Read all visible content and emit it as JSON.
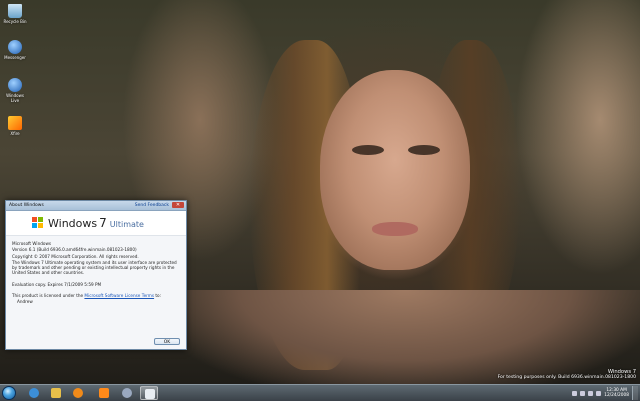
{
  "desktop": {
    "icons": [
      {
        "label": "Recycle Bin",
        "icon": "recycle-bin-icon"
      },
      {
        "label": "Messenger",
        "icon": "messenger-icon"
      },
      {
        "label": "Windows Live",
        "icon": "windows-live-icon"
      },
      {
        "label": "Xfire",
        "icon": "xfire-icon"
      }
    ]
  },
  "about_dialog": {
    "title": "About Windows",
    "feedback_link": "Send Feedback",
    "close_label": "✕",
    "brand_windows": "Windows",
    "brand_version": "7",
    "brand_edition": "Ultimate",
    "product_name": "Microsoft Windows",
    "version_line": "Version 6.1 (Build 6936.0.amd64fre.winmain.081023-1800)",
    "copyright": "Copyright © 2007 Microsoft Corporation.  All rights reserved.",
    "legal_text": "The Windows 7 Ultimate operating system and its user interface are protected by trademark and other pending or existing intellectual property rights in the United States and other countries.",
    "evaluation": "Evaluation copy. Expires 7/1/2009 5:59 PM",
    "license_prefix": "This product is licensed under the",
    "license_link": "Microsoft Software License Terms",
    "license_suffix": " to:",
    "licensee": "Andrew",
    "ok_label": "OK"
  },
  "watermark": {
    "line1": "Windows 7",
    "line2": "For testing purposes only. Build 6936.winmain.081023-1800"
  },
  "taskbar": {
    "clock_time": "12:30 AM",
    "clock_date": "12/24/2008",
    "pinned": [
      {
        "name": "internet-explorer-icon",
        "color": "#3c8fd8"
      },
      {
        "name": "explorer-icon",
        "color": "#e8c04a"
      },
      {
        "name": "media-player-icon",
        "color": "#f08a1a"
      },
      {
        "name": "xfire-icon",
        "color": "#ff8a1a"
      },
      {
        "name": "steam-icon",
        "color": "#9aa9c0"
      },
      {
        "name": "windows-flag-icon",
        "color": "#e9eef3"
      }
    ]
  },
  "colors": {
    "flag_red": "#f25022",
    "flag_green": "#7fba00",
    "flag_blue": "#00a4ef",
    "flag_yellow": "#ffb900"
  }
}
